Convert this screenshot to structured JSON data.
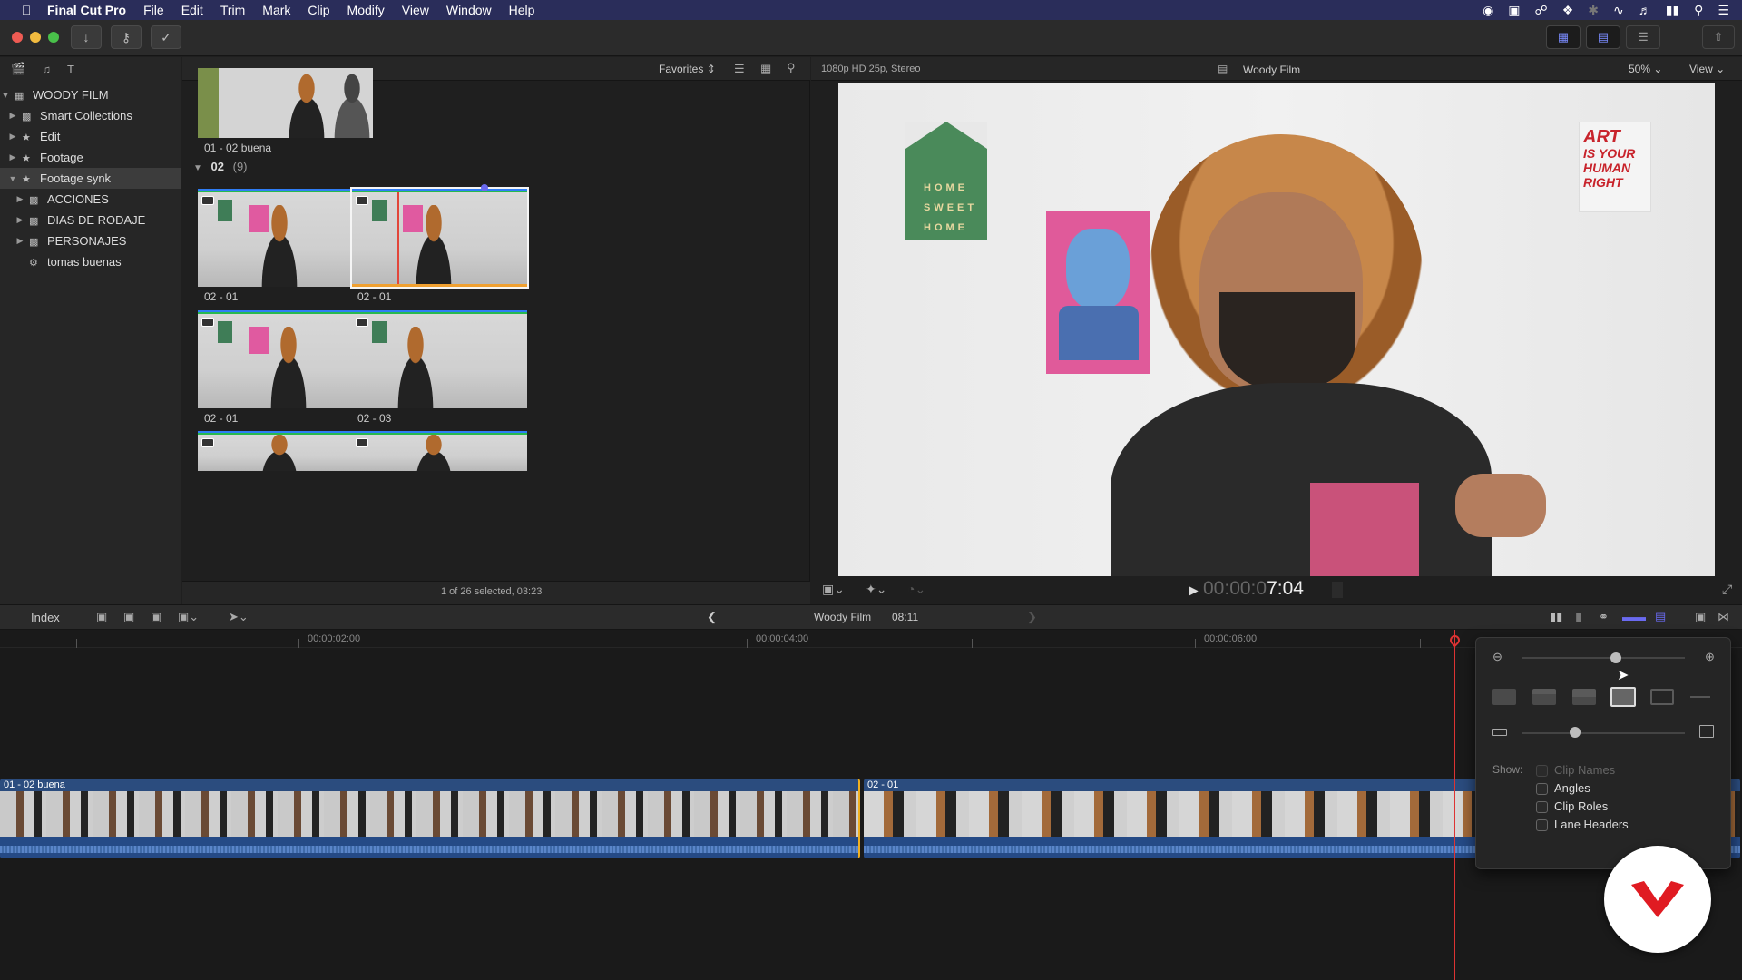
{
  "menubar": {
    "app": "Final Cut Pro",
    "items": [
      "File",
      "Edit",
      "Trim",
      "Mark",
      "Clip",
      "Modify",
      "View",
      "Window",
      "Help"
    ]
  },
  "library": {
    "name": "WOODY FILM",
    "items": [
      {
        "label": "Smart Collections",
        "level": 1,
        "icon": "folder-icon"
      },
      {
        "label": "Edit",
        "level": 1,
        "icon": "star-event-icon"
      },
      {
        "label": "Footage",
        "level": 1,
        "icon": "star-event-icon"
      },
      {
        "label": "Footage synk",
        "level": 1,
        "icon": "star-event-icon",
        "selected": true
      },
      {
        "label": "ACCIONES",
        "level": 2,
        "icon": "folder-icon"
      },
      {
        "label": "DIAS DE RODAJE",
        "level": 2,
        "icon": "folder-icon"
      },
      {
        "label": "PERSONAJES",
        "level": 2,
        "icon": "folder-icon"
      },
      {
        "label": "tomas buenas",
        "level": 2,
        "icon": "gear-icon"
      }
    ]
  },
  "browser": {
    "filter": "Favorites",
    "group_name": "02",
    "group_count": "(9)",
    "top_clip": "01 - 02 buena",
    "clips": [
      "02 - 01",
      "02 - 01",
      "02 - 01",
      "02 - 03"
    ],
    "status": "1 of 26 selected, 03:23"
  },
  "viewer": {
    "format": "1080p HD 25p, Stereo",
    "project": "Woody Film",
    "zoom": "50%",
    "view_label": "View",
    "timecode_dim": "00:00:0",
    "timecode_bright": "7:04",
    "poster_text": [
      "ART",
      "IS YOUR",
      "HUMAN",
      "RIGHT"
    ],
    "poster_green_text": [
      "HOME",
      "SWEET",
      "HOME"
    ]
  },
  "timeline": {
    "index_label": "Index",
    "project": "Woody Film",
    "duration": "08:11",
    "ruler": [
      "00:00:02:00",
      "00:00:04:00",
      "00:00:06:00"
    ],
    "clips": [
      {
        "name": "01 - 02 buena"
      },
      {
        "name": "02 - 01"
      }
    ]
  },
  "clip_appearance": {
    "show_label": "Show:",
    "options": [
      {
        "label": "Clip Names",
        "checked": true,
        "disabled": true
      },
      {
        "label": "Angles",
        "checked": false
      },
      {
        "label": "Clip Roles",
        "checked": false
      },
      {
        "label": "Lane Headers",
        "checked": false
      }
    ],
    "zoom_level": 0.58,
    "height_level": 0.33
  },
  "colors": {
    "menubar": "#2a2d5a",
    "accent": "#5b6cf5",
    "playhead": "#dd3333",
    "selection": "#f0a030"
  }
}
